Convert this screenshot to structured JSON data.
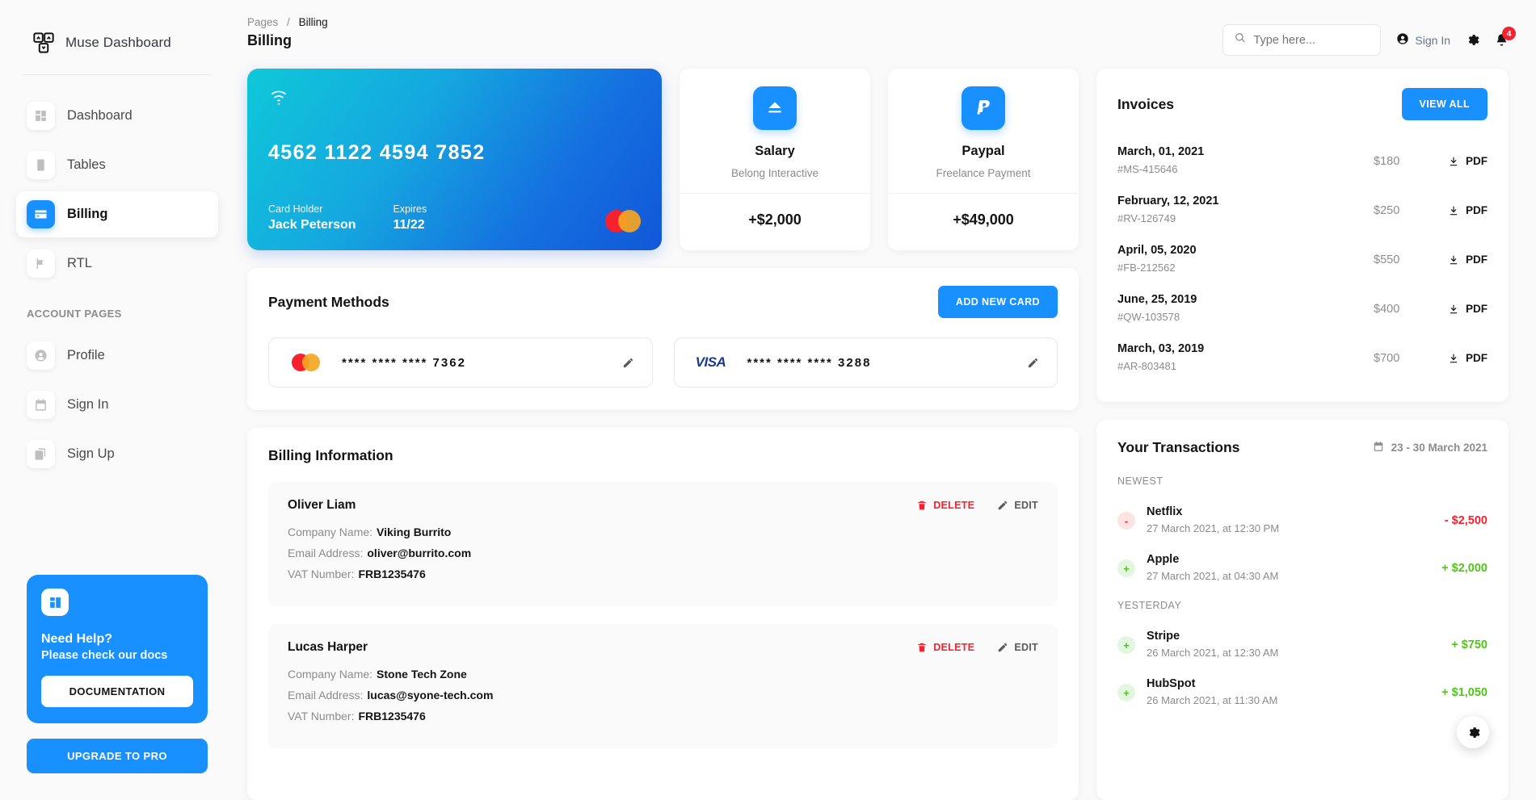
{
  "sidebar": {
    "brand": "Muse Dashboard",
    "items": [
      {
        "label": "Dashboard",
        "icon": "dashboard-icon",
        "active": false
      },
      {
        "label": "Tables",
        "icon": "tables-icon",
        "active": false
      },
      {
        "label": "Billing",
        "icon": "billing-icon",
        "active": true
      },
      {
        "label": "RTL",
        "icon": "flag-icon",
        "active": false
      }
    ],
    "section_title": "ACCOUNT PAGES",
    "account_items": [
      {
        "label": "Profile",
        "icon": "person-icon"
      },
      {
        "label": "Sign In",
        "icon": "calendar-icon"
      },
      {
        "label": "Sign Up",
        "icon": "copy-icon"
      }
    ],
    "help": {
      "title": "Need Help?",
      "subtitle": "Please check our docs",
      "button": "DOCUMENTATION"
    },
    "pro_button": "UPGRADE TO PRO"
  },
  "header": {
    "breadcrumb_parent": "Pages",
    "breadcrumb_sep": "/",
    "breadcrumb_current": "Billing",
    "title": "Billing",
    "search_placeholder": "Type here...",
    "sign_in": "Sign In",
    "notification_count": "4"
  },
  "credit_card": {
    "number": "4562  1122  4594  7852",
    "holder_label": "Card Holder",
    "holder_value": "Jack Peterson",
    "expires_label": "Expires",
    "expires_value": "11/22",
    "brand": "mastercard",
    "gradient_from": "#0fc8d8",
    "gradient_to": "#1157d9"
  },
  "mini_cards": [
    {
      "icon": "salary-icon",
      "title": "Salary",
      "subtitle": "Belong Interactive",
      "amount": "+$2,000"
    },
    {
      "icon": "paypal-icon",
      "title": "Paypal",
      "subtitle": "Freelance Payment",
      "amount": "+$49,000"
    }
  ],
  "payment_methods": {
    "title": "Payment Methods",
    "add_button": "ADD NEW CARD",
    "cards": [
      {
        "brand": "mastercard",
        "masked": "****  ****  ****  7362"
      },
      {
        "brand": "visa",
        "brand_text": "VISA",
        "masked": "****  ****  ****  3288"
      }
    ]
  },
  "billing_information": {
    "title": "Billing Information",
    "labels": {
      "company": "Company Name:",
      "email": "Email Address:",
      "vat": "VAT Number:"
    },
    "delete_label": "DELETE",
    "edit_label": "EDIT",
    "entries": [
      {
        "name": "Oliver Liam",
        "company": "Viking Burrito",
        "email": "oliver@burrito.com",
        "vat": "FRB1235476"
      },
      {
        "name": "Lucas Harper",
        "company": "Stone Tech Zone",
        "email": "lucas@syone-tech.com",
        "vat": "FRB1235476"
      }
    ]
  },
  "invoices": {
    "title": "Invoices",
    "view_all": "VIEW ALL",
    "pdf_label": "PDF",
    "rows": [
      {
        "date": "March, 01, 2021",
        "id": "#MS-415646",
        "amount": "$180"
      },
      {
        "date": "February, 12, 2021",
        "id": "#RV-126749",
        "amount": "$250"
      },
      {
        "date": "April, 05, 2020",
        "id": "#FB-212562",
        "amount": "$550"
      },
      {
        "date": "June, 25, 2019",
        "id": "#QW-103578",
        "amount": "$400"
      },
      {
        "date": "March, 03, 2019",
        "id": "#AR-803481",
        "amount": "$700"
      }
    ]
  },
  "transactions": {
    "title": "Your Transactions",
    "date_range": "23 - 30 March 2021",
    "groups": [
      {
        "label": "NEWEST",
        "items": [
          {
            "name": "Netflix",
            "time": "27 March 2021, at 12:30 PM",
            "amount": "- $2,500",
            "sign": "-",
            "type": "neg"
          },
          {
            "name": "Apple",
            "time": "27 March 2021, at 04:30 AM",
            "amount": "+ $2,000",
            "sign": "+",
            "type": "pos"
          }
        ]
      },
      {
        "label": "YESTERDAY",
        "items": [
          {
            "name": "Stripe",
            "time": "26 March 2021, at 12:30 AM",
            "amount": "+ $750",
            "sign": "+",
            "type": "pos"
          },
          {
            "name": "HubSpot",
            "time": "26 March 2021, at 11:30 AM",
            "amount": "+ $1,050",
            "sign": "+",
            "type": "pos"
          }
        ]
      }
    ]
  },
  "colors": {
    "accent": "#1890ff",
    "danger": "#f5222d",
    "success": "#52c41a",
    "muted": "#8c8c8c"
  }
}
